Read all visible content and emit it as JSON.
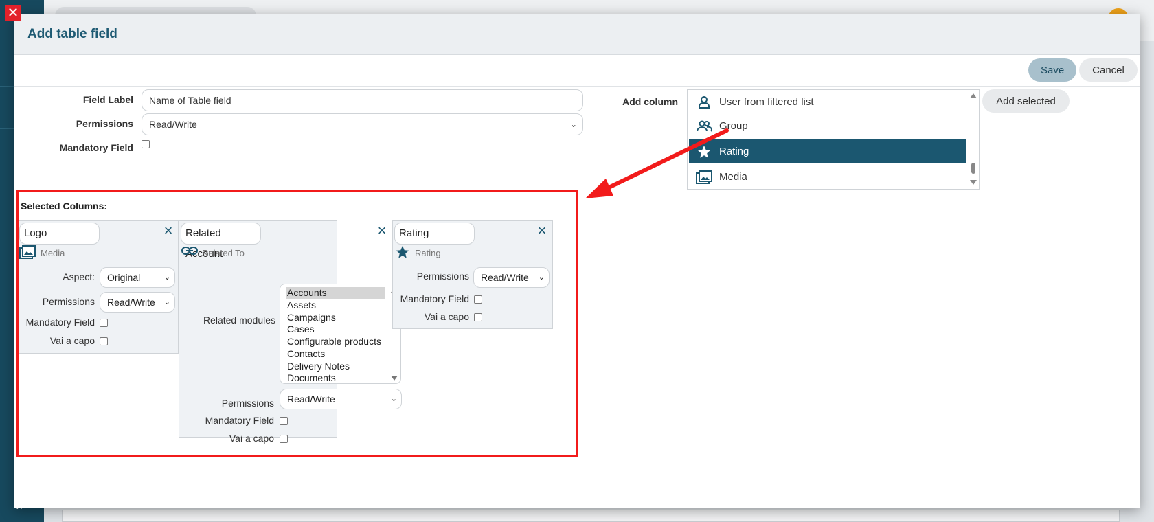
{
  "modal": {
    "title": "Add table field",
    "save_label": "Save",
    "cancel_label": "Cancel"
  },
  "form": {
    "field_label_label": "Field Label",
    "field_label_value": "Name of Table field",
    "permissions_label": "Permissions",
    "permissions_value": "Read/Write",
    "mandatory_label": "Mandatory Field",
    "add_column_label": "Add column",
    "add_selected_label": "Add selected"
  },
  "column_list": {
    "items": [
      {
        "label": "User from filtered list",
        "icon": "user-icon"
      },
      {
        "label": "Group",
        "icon": "group-icon"
      },
      {
        "label": "Rating",
        "icon": "star-icon",
        "selected": true
      },
      {
        "label": "Media",
        "icon": "media-icon"
      }
    ]
  },
  "selected_columns": {
    "title": "Selected Columns:",
    "logo": {
      "name": "Logo",
      "type": "Media",
      "aspect_label": "Aspect:",
      "aspect_value": "Original",
      "permissions_label": "Permissions",
      "permissions_value": "Read/Write",
      "mandatory_label": "Mandatory Field",
      "vai_label": "Vai a capo"
    },
    "related": {
      "name": "Related Account",
      "type": "Related To",
      "modules_label": "Related modules",
      "modules": [
        "Accounts",
        "Assets",
        "Campaigns",
        "Cases",
        "Configurable products",
        "Contacts",
        "Delivery Notes",
        "Documents"
      ],
      "permissions_label": "Permissions",
      "permissions_value": "Read/Write",
      "mandatory_label": "Mandatory Field",
      "vai_label": "Vai a capo"
    },
    "rating": {
      "name": "Rating",
      "type": "Rating",
      "permissions_label": "Permissions",
      "permissions_value": "Read/Write",
      "mandatory_label": "Mandatory Field",
      "vai_label": "Vai a capo"
    }
  },
  "colors": {
    "accent": "#1b5770",
    "annotation_red": "#f21b1b"
  }
}
